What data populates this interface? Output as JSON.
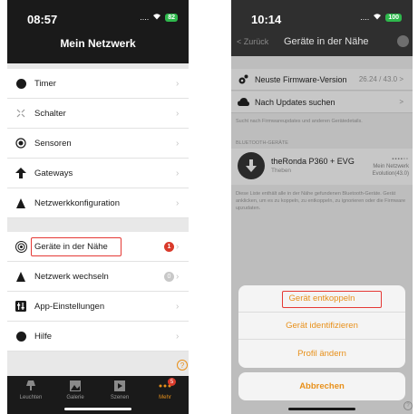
{
  "phone1": {
    "status": {
      "time": "08:57",
      "signal": "....",
      "battery": "82"
    },
    "title": "Mein Netzwerk",
    "menu": [
      {
        "label": "Timer",
        "icon": "clock-icon"
      },
      {
        "label": "Schalter",
        "icon": "switch-icon"
      },
      {
        "label": "Sensoren",
        "icon": "sensor-icon"
      },
      {
        "label": "Gateways",
        "icon": "gateway-icon"
      },
      {
        "label": "Netzwerkkonfiguration",
        "icon": "network-config-icon"
      }
    ],
    "menu2": [
      {
        "label": "Geräte in der Nähe",
        "icon": "nearby-devices-icon",
        "badge": "1"
      },
      {
        "label": "Netzwerk wechseln",
        "icon": "network-switch-icon",
        "badge": "0"
      },
      {
        "label": "App-Einstellungen",
        "icon": "app-settings-icon"
      },
      {
        "label": "Hilfe",
        "icon": "help-icon"
      }
    ],
    "help_symbol": "?",
    "tabs": [
      {
        "label": "Leuchten",
        "icon": "lamp-icon"
      },
      {
        "label": "Galerie",
        "icon": "gallery-icon"
      },
      {
        "label": "Szenen",
        "icon": "scenes-icon"
      },
      {
        "label": "Mehr",
        "icon": "more-icon",
        "badge": "5"
      }
    ],
    "colors": {
      "accent": "#e8901a",
      "highlight": "#e53935",
      "header": "#1a1a1a"
    }
  },
  "phone2": {
    "status": {
      "time": "10:14",
      "signal": "....",
      "battery": "100"
    },
    "back_label": "< Zurück",
    "title": "Geräte in der Nähe",
    "firmware": {
      "label": "Neuste Firmware-Version",
      "value": "26.24 / 43.0 >"
    },
    "updates": {
      "label": "Nach Updates suchen",
      "chevron": ">"
    },
    "search_note": "Sucht nach Firmwareupdates und anderen Gerätedetails.",
    "section_header": "BLUETOOTH-GERÄTE",
    "device": {
      "name": "theRonda P360 + EVG",
      "vendor": "Theben",
      "signal": "▪▪▪▪▫▫",
      "network": "Mein Netzwerk",
      "firmware": "Evolution(43.0)"
    },
    "list_note": "Diese Liste enthält alle in der Nähe gefundenen Bluetooth-Geräte. Gerät anklicken, um es zu koppeln, zu entkoppeln, zu ignorieren oder die Firmware upzudaten.",
    "actions": [
      "Gerät entkoppeln",
      "Gerät identifizieren",
      "Profil ändern"
    ],
    "cancel": "Abbrechen",
    "help_symbol": "?"
  }
}
